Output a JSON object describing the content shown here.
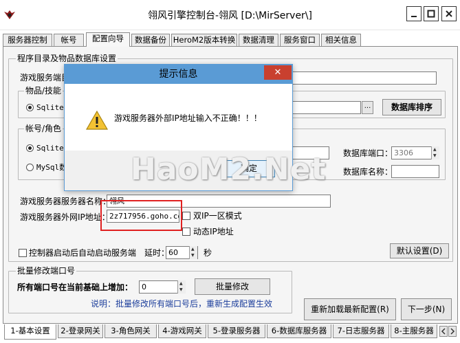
{
  "window": {
    "title": "翎风引擎控制台-翎风 [D:\\MirServer\\]",
    "icon": "wing-logo-icon",
    "controls": {
      "minimize": "minimize-icon",
      "maximize": "maximize-icon",
      "close": "close-icon"
    }
  },
  "top_tabs": [
    {
      "label": "服务器控制"
    },
    {
      "label": "帐号"
    },
    {
      "label": "配置向导"
    },
    {
      "label": "数据备份"
    },
    {
      "label": "HeroM2版本转换"
    },
    {
      "label": "数据清理"
    },
    {
      "label": "服务窗口"
    },
    {
      "label": "相关信息"
    }
  ],
  "config": {
    "program_group_label": "程序目录及物品数据库设置",
    "game_port_label": "游戏服务端目",
    "item_group_label": "物品/技能",
    "item_radio_sqlite": "Sqlite数",
    "browse_label": "...",
    "db_sort_button": "数据库排序",
    "account_group_label": "帐号/角色",
    "account_radio_sqlite": "Sqlite数",
    "account_radio_mysql": "MySql数",
    "db_port_label": "数据库端口：",
    "db_port_value": "3306",
    "db_name_label": "数据库名称：",
    "server_name_label": "游戏服务器服务器名称：",
    "server_name_value": "翎风",
    "external_ip_label": "游戏服务器外网IP地址：",
    "external_ip_value": "2z717956.goho.co",
    "dual_ip_label": "双IP一区模式",
    "dynamic_ip_label": "动态IP地址",
    "autostart_label": "控制器启动后自动启动服务端",
    "delay_label": "延时：",
    "delay_value": "60",
    "delay_unit": "秒",
    "default_button": "默认设置(D)"
  },
  "batch": {
    "group_label": "批量修改端口号",
    "increase_label": "所有端口号在当前基础上增加：",
    "increase_value": "0",
    "modify_button": "批量修改",
    "note": "说明：批量修改所有端口号后，重新生成配置生效"
  },
  "actions": {
    "reload_button": "重新加载最新配置(R)",
    "next_button": "下一步(N)"
  },
  "bottom_tabs": [
    {
      "label": "1-基本设置"
    },
    {
      "label": "2-登录网关"
    },
    {
      "label": "3-角色网关"
    },
    {
      "label": "4-游戏网关"
    },
    {
      "label": "5-登录服务器"
    },
    {
      "label": "6-数据库服务器"
    },
    {
      "label": "7-日志服务器"
    },
    {
      "label": "8-主服务器"
    }
  ],
  "dialog": {
    "title": "提示信息",
    "icon": "warning-icon",
    "message": "游戏服务器外部IP地址输入不正确！！！",
    "ok_button": "确定",
    "close_glyph": "✕"
  },
  "watermark": "HaoM2.Net",
  "colors": {
    "dialog_titlebar": "#5a9bd5",
    "dialog_close": "#c9402f",
    "highlight": "#e02020"
  }
}
